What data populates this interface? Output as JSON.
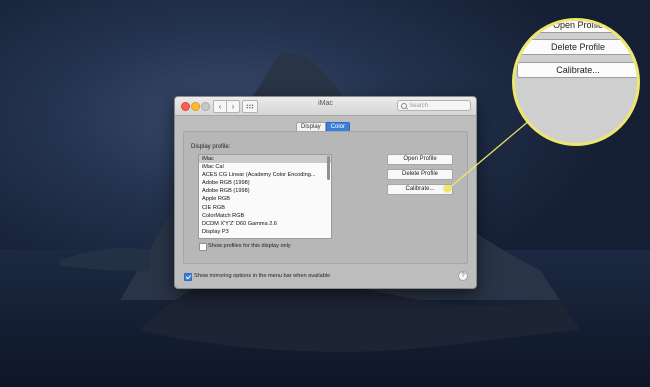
{
  "window": {
    "title": "iMac",
    "search_placeholder": "Search",
    "nav_back": "‹",
    "nav_forward": "›"
  },
  "tabs": [
    {
      "label": "Display",
      "selected": false
    },
    {
      "label": "Color",
      "selected": true
    }
  ],
  "color_pane": {
    "profile_label": "Display profile:",
    "profiles": [
      "iMac",
      "iMac Cal",
      "ACES CG Linear (Academy Color Encoding...",
      "Adobe RGB (1998)",
      "Adobe RGB (1998)",
      "Apple RGB",
      "CIE RGB",
      "ColorMatch RGB",
      "DCDM X'Y'Z' D60 Gamma 2.6",
      "Display P3"
    ],
    "selected_profile_index": 0,
    "show_profiles_label": "Show profiles for this display only",
    "show_profiles_checked": false,
    "buttons": {
      "open": "Open Profile",
      "delete": "Delete Profile",
      "calibrate": "Calibrate..."
    },
    "mirroring_label": "Show mirroring options in the menu bar when available",
    "mirroring_checked": true,
    "help_label": "?"
  },
  "callout": {
    "open": "Open Profile",
    "delete": "Delete Profile",
    "calibrate": "Calibrate..."
  },
  "colors": {
    "accent": "#3d7ed8",
    "highlight": "#efe76b"
  }
}
